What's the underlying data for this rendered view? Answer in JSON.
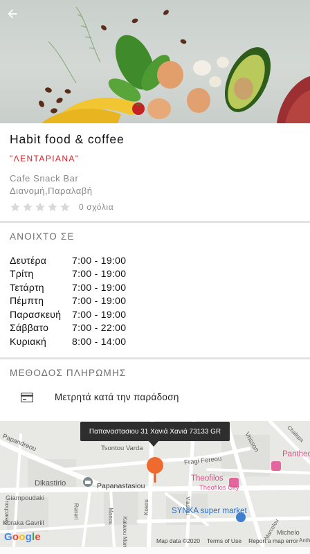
{
  "header": {
    "back_icon": "arrow-back-icon"
  },
  "store": {
    "name": "Habit food & coffee",
    "area": "\"ΛΕΝΤΑΡΙΑΝΑ\"",
    "category": "Cafe Snack Bar",
    "services": "Διανομή,Παραλαβή",
    "rating": 0,
    "rating_max": 5,
    "reviews_label": "0 σχόλια"
  },
  "hours_section": {
    "title": "ΑΝΟΙΧΤΟ ΣΕ",
    "days": [
      {
        "day": "Δευτέρα",
        "time": "7:00 - 19:00"
      },
      {
        "day": "Τρίτη",
        "time": "7:00 - 19:00"
      },
      {
        "day": "Τετάρτη",
        "time": "7:00 - 19:00"
      },
      {
        "day": "Πέμπτη",
        "time": "7:00 - 19:00"
      },
      {
        "day": "Παρασκευή",
        "time": "7:00 - 19:00"
      },
      {
        "day": "Σάββατο",
        "time": "7:00 - 22:00"
      },
      {
        "day": "Κυριακή",
        "time": "8:00 - 14:00"
      }
    ]
  },
  "payment_section": {
    "title": "ΜΕΘΟΔΟΣ ΠΛΗΡΩΜΗΣ",
    "methods": [
      {
        "icon": "credit-card-icon",
        "label": "Μετρητά κατά την παράδοση"
      }
    ]
  },
  "map": {
    "address_tooltip": "Παπαναστασιου 31 Χανιά Χανιά 73133 GR",
    "streets": [
      "Papandreou",
      "Tsontou Varda",
      "Papanastasiou",
      "Dikastirio",
      "Giampoudaki",
      "Reneri",
      "Manou",
      "Nearchou",
      "Koraka Gavriil",
      "Kalaiou Manou",
      "Vrisson",
      "Fragi Fereou",
      "Vlastou",
      "Kosou",
      "Marcelou",
      "Chalepa",
      "Michelo",
      "Anthea"
    ],
    "pois": [
      {
        "name": "Pantheon Ap",
        "color": "#d64f85"
      },
      {
        "name": "Theofilos",
        "color": "#d64f85"
      },
      {
        "name": "Theofilos City",
        "color": "#d64f85"
      },
      {
        "name": "SYNKA super market",
        "color": "#2b6bbf"
      }
    ],
    "logo": "Google",
    "attribution": [
      "Map data ©2020",
      "Terms of Use",
      "Report a map error"
    ]
  }
}
